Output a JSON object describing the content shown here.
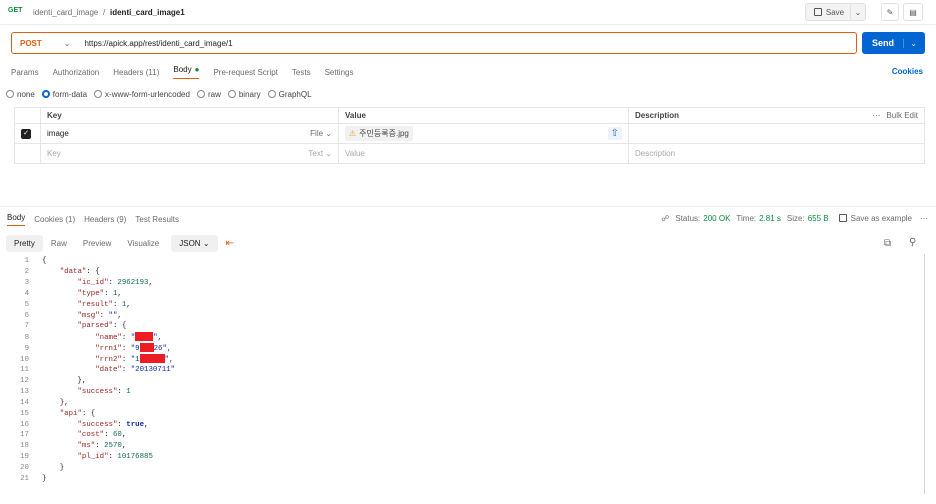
{
  "topbar": {
    "icon": "http-icon",
    "icon_text": "GET",
    "collection": "identi_card_image",
    "separator": "/",
    "request_name": "identi_card_image1",
    "save_label": "Save"
  },
  "request": {
    "method": "POST",
    "url": "https://apick.app/rest/identi_card_image/1",
    "send_label": "Send"
  },
  "req_tabs": {
    "params": "Params",
    "authorization": "Authorization",
    "headers": "Headers (11)",
    "body": "Body",
    "prerequest": "Pre-request Script",
    "tests": "Tests",
    "settings": "Settings",
    "cookies": "Cookies"
  },
  "body_types": [
    "none",
    "form-data",
    "x-www-form-urlencoded",
    "raw",
    "binary",
    "GraphQL"
  ],
  "table": {
    "headers": {
      "key": "Key",
      "value": "Value",
      "description": "Description",
      "bulk": "Bulk Edit"
    },
    "row": {
      "key": "image",
      "type": "File",
      "value": "주민등록증.jpg"
    },
    "empty_row": {
      "key": "Key",
      "type": "Text",
      "value": "Value",
      "description": "Description"
    }
  },
  "response": {
    "tabs": {
      "body": "Body",
      "cookies": "Cookies (1)",
      "headers": "Headers (9)",
      "tests": "Test Results"
    },
    "status_label": "Status:",
    "status_value": "200 OK",
    "time_label": "Time:",
    "time_value": "2.81 s",
    "size_label": "Size:",
    "size_value": "655 B",
    "save_example": "Save as example",
    "format_tabs": {
      "pretty": "Pretty",
      "raw": "Raw",
      "preview": "Preview",
      "visualize": "Visualize",
      "json": "JSON"
    }
  },
  "code_lines": [
    {
      "n": "1",
      "t": "{"
    },
    {
      "n": "2",
      "t": "    \"data\": {"
    },
    {
      "n": "3",
      "t": "        \"ic_id\": 2962193,"
    },
    {
      "n": "4",
      "t": "        \"type\": 1,"
    },
    {
      "n": "5",
      "t": "        \"result\": 1,"
    },
    {
      "n": "6",
      "t": "        \"msg\": \"\","
    },
    {
      "n": "7",
      "t": "        \"parsed\": {"
    },
    {
      "n": "8",
      "t": "            \"name\": \"",
      "redact": true,
      "w": 18,
      "tail": "\","
    },
    {
      "n": "9",
      "t": "            \"rrn1\": \"9",
      "redact": true,
      "w": 14,
      "tail": "26\","
    },
    {
      "n": "10",
      "t": "            \"rrn2\": \"1",
      "redact": true,
      "w": 25,
      "tail": "\","
    },
    {
      "n": "11",
      "t": "            \"date\": \"20130711\""
    },
    {
      "n": "12",
      "t": "        },"
    },
    {
      "n": "13",
      "t": "        \"success\": 1"
    },
    {
      "n": "14",
      "t": "    },"
    },
    {
      "n": "15",
      "t": "    \"api\": {"
    },
    {
      "n": "16",
      "t": "        \"success\": true,"
    },
    {
      "n": "17",
      "t": "        \"cost\": 60,"
    },
    {
      "n": "18",
      "t": "        \"ms\": 2570,"
    },
    {
      "n": "19",
      "t": "        \"pl_id\": 10176885"
    },
    {
      "n": "20",
      "t": "    }"
    },
    {
      "n": "21",
      "t": "}"
    }
  ]
}
